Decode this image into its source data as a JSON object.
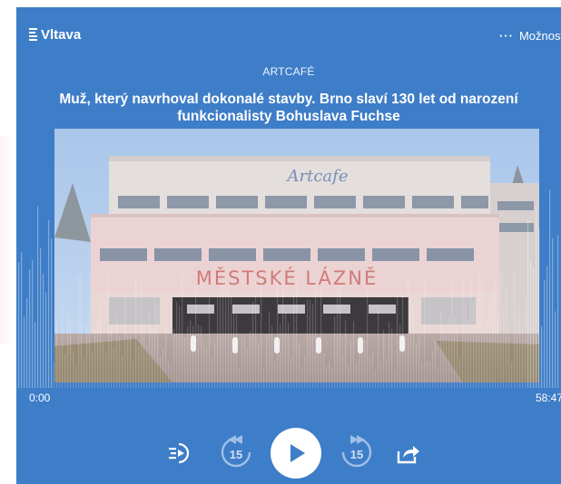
{
  "app": {
    "station": "Vltava",
    "more_label": "Možnosti"
  },
  "episode": {
    "show": "ARTCAFÉ",
    "title_line1": "Muž, který navrhoval dokonalé stavby. Brno slaví 130 let od narození",
    "title_line2": "funkcionalisty Bohuslava Fuchse",
    "artwork": {
      "sign_main": "MĚSTSKÉ LÁZNĚ",
      "sign_script": "Artcafe"
    }
  },
  "playback": {
    "current_time": "0:00",
    "total_time": "58:47",
    "skip_back_seconds": "15",
    "skip_forward_seconds": "15",
    "progress": 0
  },
  "controls": {
    "speed": "speed-icon",
    "rewind": "rewind-15-icon",
    "play": "play-icon",
    "forward": "forward-15-icon",
    "share": "share-icon"
  },
  "colors": {
    "player_bg": "#3e7dc7",
    "play_icon": "#3e7dc7",
    "skip_icon": "#9fbfe8"
  }
}
